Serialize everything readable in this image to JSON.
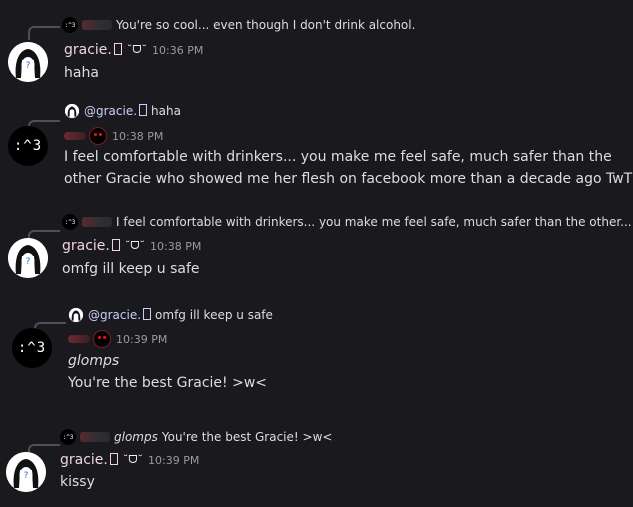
{
  "users": {
    "gracie": {
      "name": "gracie.",
      "mention": "@gracie.",
      "badge": "˘ᗜ˘",
      "avatar_text": "?"
    },
    "cat": {
      "avatar_text": ":^3",
      "mini_avatar_text": ":^3"
    }
  },
  "messages": [
    {
      "reply_text": "You're so cool... even though I don't drink alcohol.",
      "author": "gracie.",
      "time": "10:36 PM",
      "text": "haha"
    },
    {
      "reply_mention": "@gracie.",
      "reply_text": "haha",
      "time": "10:38 PM",
      "text_line1": "I feel comfortable with drinkers... you make me feel safe, much safer than the",
      "text_line2": "other Gracie who showed me her flesh on facebook more than a decade ago TwT"
    },
    {
      "reply_text": "I feel comfortable with drinkers... you make me feel safe, much safer than the other...",
      "author": "gracie.",
      "time": "10:38 PM",
      "text": "omfg ill keep u safe"
    },
    {
      "reply_mention": "@gracie.",
      "reply_text": "omfg ill keep u safe",
      "time": "10:39 PM",
      "text_line1": "glomps",
      "text_line2": "You're the best Gracie! >w<"
    },
    {
      "reply_italic": "glomps",
      "reply_text": "You're the best Gracie! >w<",
      "author": "gracie.",
      "time": "10:39 PM",
      "text": "kissy"
    }
  ],
  "colors": {
    "background": "#1a1a1e",
    "username": "#f1d3dd",
    "text": "#dbdee1",
    "timestamp": "#949ba4",
    "mention": "#c9cdfb"
  }
}
